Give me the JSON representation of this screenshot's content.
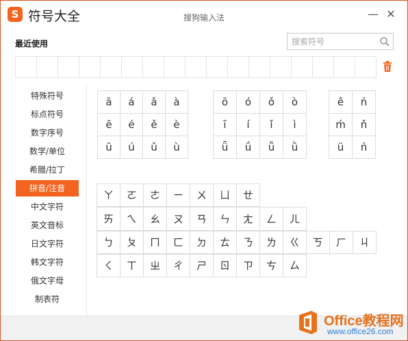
{
  "window": {
    "logo": "S",
    "title": "符号大全",
    "subtitle": "搜狗输入法",
    "minimize": "—",
    "close": "✕"
  },
  "recent": {
    "label": "最近使用"
  },
  "search": {
    "placeholder": "搜索符号",
    "icon": "search-icon"
  },
  "sidebar": {
    "items": [
      {
        "label": "特殊符号"
      },
      {
        "label": "标点符号"
      },
      {
        "label": "数字序号"
      },
      {
        "label": "数学/单位"
      },
      {
        "label": "希腊/拉丁"
      },
      {
        "label": "拼音/注音"
      },
      {
        "label": "中文字符"
      },
      {
        "label": "英文音标"
      },
      {
        "label": "日文字符"
      },
      {
        "label": "韩文字符"
      },
      {
        "label": "俄文字母"
      },
      {
        "label": "制表符"
      }
    ],
    "active": "拼音/注音"
  },
  "pinyin": {
    "group_a": [
      "ā",
      "á",
      "ǎ",
      "à",
      "ē",
      "é",
      "ě",
      "è",
      "ū",
      "ú",
      "ǔ",
      "ù"
    ],
    "group_o": [
      "ō",
      "ó",
      "ǒ",
      "ò",
      "ī",
      "í",
      "ǐ",
      "ì",
      "ǖ",
      "ǘ",
      "ǚ",
      "ǜ"
    ],
    "group_other": [
      "ê",
      "ń",
      "ḿ",
      "ň",
      "ü",
      "ǹ"
    ]
  },
  "zhuyin": {
    "row1": [
      "ㄚ",
      "ㄛ",
      "ㄜ",
      "ㄧ",
      "ㄨ",
      "ㄩ",
      "ㄝ"
    ],
    "row2": [
      "ㄞ",
      "ㄟ",
      "ㄠ",
      "ㄡ",
      "ㄢ",
      "ㄣ",
      "ㄤ",
      "ㄥ",
      "ㄦ"
    ],
    "row3": [
      "ㄅ",
      "ㄆ",
      "ㄇ",
      "ㄈ",
      "ㄉ",
      "ㄊ",
      "ㄋ",
      "ㄌ",
      "ㄍ",
      "ㄎ",
      "ㄏ",
      "ㄐ"
    ],
    "row4": [
      "ㄑ",
      "ㄒ",
      "ㄓ",
      "ㄔ",
      "ㄕ",
      "ㄖ",
      "ㄗ",
      "ㄘ",
      "ㄙ"
    ]
  },
  "watermark": {
    "text": "Office教程网",
    "url": "www.office26.com"
  },
  "colors": {
    "accent": "#f2641f"
  }
}
